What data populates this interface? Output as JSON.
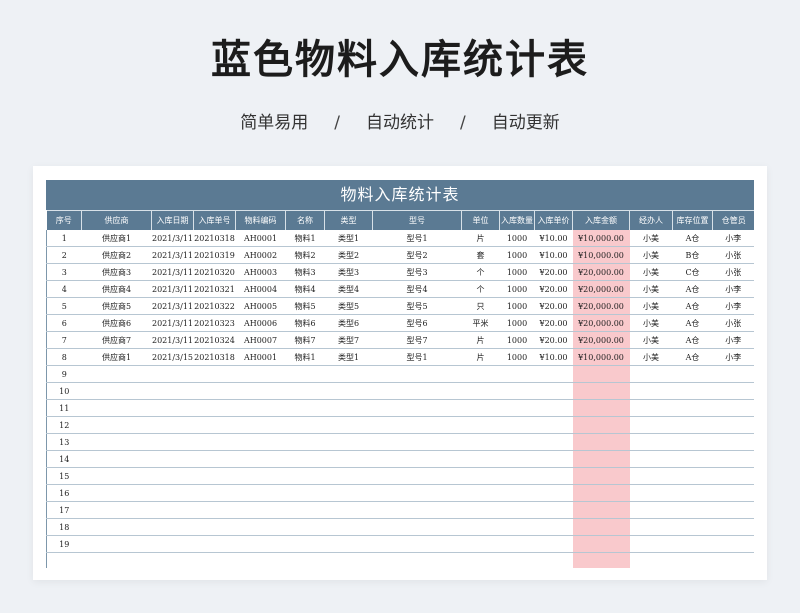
{
  "page": {
    "title": "蓝色物料入库统计表",
    "tags": [
      "简单易用",
      "自动统计",
      "自动更新"
    ],
    "separator": "/"
  },
  "sheet": {
    "title": "物料入库统计表",
    "columns": [
      "序号",
      "供应商",
      "入库日期",
      "入库单号",
      "物料编码",
      "名称",
      "类型",
      "型号",
      "单位",
      "入库数量",
      "入库单价",
      "入库金额",
      "经办人",
      "库存位置",
      "仓管员"
    ],
    "rows": [
      [
        "1",
        "供应商1",
        "2021/3/11",
        "20210318",
        "AH0001",
        "物料1",
        "类型1",
        "型号1",
        "片",
        "1000",
        "¥10.00",
        "¥10,000.00",
        "小美",
        "A仓",
        "小李"
      ],
      [
        "2",
        "供应商2",
        "2021/3/11",
        "20210319",
        "AH0002",
        "物料2",
        "类型2",
        "型号2",
        "套",
        "1000",
        "¥10.00",
        "¥10,000.00",
        "小美",
        "B仓",
        "小张"
      ],
      [
        "3",
        "供应商3",
        "2021/3/11",
        "20210320",
        "AH0003",
        "物料3",
        "类型3",
        "型号3",
        "个",
        "1000",
        "¥20.00",
        "¥20,000.00",
        "小美",
        "C仓",
        "小张"
      ],
      [
        "4",
        "供应商4",
        "2021/3/11",
        "20210321",
        "AH0004",
        "物料4",
        "类型4",
        "型号4",
        "个",
        "1000",
        "¥20.00",
        "¥20,000.00",
        "小美",
        "A仓",
        "小李"
      ],
      [
        "5",
        "供应商5",
        "2021/3/11",
        "20210322",
        "AH0005",
        "物料5",
        "类型5",
        "型号5",
        "只",
        "1000",
        "¥20.00",
        "¥20,000.00",
        "小美",
        "A仓",
        "小李"
      ],
      [
        "6",
        "供应商6",
        "2021/3/11",
        "20210323",
        "AH0006",
        "物料6",
        "类型6",
        "型号6",
        "平米",
        "1000",
        "¥20.00",
        "¥20,000.00",
        "小美",
        "A仓",
        "小张"
      ],
      [
        "7",
        "供应商7",
        "2021/3/11",
        "20210324",
        "AH0007",
        "物料7",
        "类型7",
        "型号7",
        "片",
        "1000",
        "¥20.00",
        "¥20,000.00",
        "小美",
        "A仓",
        "小李"
      ],
      [
        "8",
        "供应商1",
        "2021/3/15",
        "20210318",
        "AH0001",
        "物料1",
        "类型1",
        "型号1",
        "片",
        "1000",
        "¥10.00",
        "¥10,000.00",
        "小美",
        "A仓",
        "小李"
      ],
      [
        "9",
        "",
        "",
        "",
        "",
        "",
        "",
        "",
        "",
        "",
        "",
        "",
        "",
        "",
        ""
      ],
      [
        "10",
        "",
        "",
        "",
        "",
        "",
        "",
        "",
        "",
        "",
        "",
        "",
        "",
        "",
        ""
      ],
      [
        "11",
        "",
        "",
        "",
        "",
        "",
        "",
        "",
        "",
        "",
        "",
        "",
        "",
        "",
        ""
      ],
      [
        "12",
        "",
        "",
        "",
        "",
        "",
        "",
        "",
        "",
        "",
        "",
        "",
        "",
        "",
        ""
      ],
      [
        "13",
        "",
        "",
        "",
        "",
        "",
        "",
        "",
        "",
        "",
        "",
        "",
        "",
        "",
        ""
      ],
      [
        "14",
        "",
        "",
        "",
        "",
        "",
        "",
        "",
        "",
        "",
        "",
        "",
        "",
        "",
        ""
      ],
      [
        "15",
        "",
        "",
        "",
        "",
        "",
        "",
        "",
        "",
        "",
        "",
        "",
        "",
        "",
        ""
      ],
      [
        "16",
        "",
        "",
        "",
        "",
        "",
        "",
        "",
        "",
        "",
        "",
        "",
        "",
        "",
        ""
      ],
      [
        "17",
        "",
        "",
        "",
        "",
        "",
        "",
        "",
        "",
        "",
        "",
        "",
        "",
        "",
        ""
      ],
      [
        "18",
        "",
        "",
        "",
        "",
        "",
        "",
        "",
        "",
        "",
        "",
        "",
        "",
        "",
        ""
      ],
      [
        "19",
        "",
        "",
        "",
        "",
        "",
        "",
        "",
        "",
        "",
        "",
        "",
        "",
        "",
        ""
      ],
      [
        "",
        "",
        "",
        "",
        "",
        "",
        "",
        "",
        "",
        "",
        "",
        "",
        "",
        "",
        ""
      ]
    ]
  },
  "colors": {
    "header_bg": "#5b7a93",
    "amount_highlight": "#f9c9cc"
  }
}
